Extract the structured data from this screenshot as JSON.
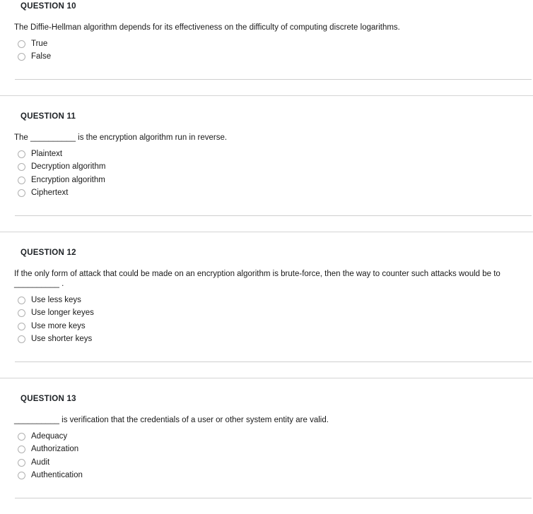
{
  "page": {
    "background_color": "#ffffff",
    "text_color": "#1a1a1a",
    "header_color": "#1c2024",
    "rule_color": "#d4d4d4",
    "radio_border_color": "#b0b0b0"
  },
  "questions": [
    {
      "header": "QUESTION 10",
      "prompt": "The Diffie-Hellman algorithm depends for its effectiveness on the difficulty of computing discrete logarithms.",
      "type": "true-false",
      "options": [
        {
          "label": "True",
          "selected": false
        },
        {
          "label": "False",
          "selected": false
        }
      ]
    },
    {
      "header": "QUESTION 11",
      "prompt": "The __________ is the encryption algorithm run in reverse.",
      "type": "multiple-choice",
      "options": [
        {
          "label": "Plaintext",
          "selected": false
        },
        {
          "label": "Decryption algorithm",
          "selected": false
        },
        {
          "label": "Encryption algorithm",
          "selected": false
        },
        {
          "label": "Ciphertext",
          "selected": false
        }
      ]
    },
    {
      "header": "QUESTION 12",
      "prompt": "If the only form of attack that could be made on an encryption algorithm is brute-force, then the way to counter such attacks would be to __________ .",
      "type": "multiple-choice",
      "options": [
        {
          "label": "Use less keys",
          "selected": false
        },
        {
          "label": "Use longer keyes",
          "selected": false
        },
        {
          "label": "Use more keys",
          "selected": false
        },
        {
          "label": "Use shorter keys",
          "selected": false
        }
      ]
    },
    {
      "header": "QUESTION 13",
      "prompt": "__________ is verification that the credentials of a user or other system entity are valid.",
      "type": "multiple-choice",
      "options": [
        {
          "label": "Adequacy",
          "selected": false
        },
        {
          "label": "Authorization",
          "selected": false
        },
        {
          "label": "Audit",
          "selected": false
        },
        {
          "label": "Authentication",
          "selected": false
        }
      ]
    }
  ]
}
